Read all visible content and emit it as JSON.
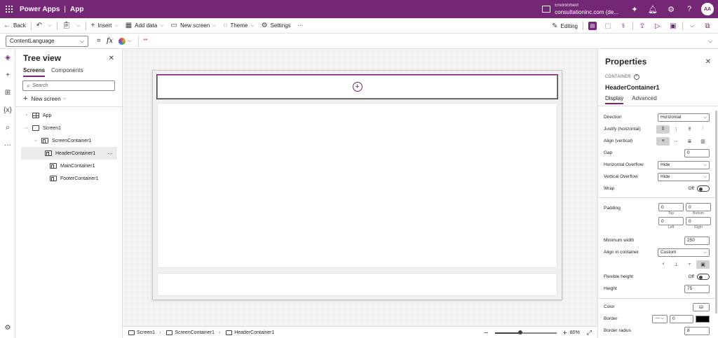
{
  "appbar": {
    "product": "Power Apps",
    "app": "App",
    "env_label": "Environment",
    "env_name": "consultationinc.com (de...",
    "avatar": "AA"
  },
  "commandbar": {
    "back": "Back",
    "insert": "Insert",
    "add_data": "Add data",
    "new_screen": "New screen",
    "theme": "Theme",
    "settings": "Settings",
    "more": "···",
    "editing": "Editing"
  },
  "formulabar": {
    "property": "ContentLanguage",
    "equals": "=",
    "fx": "fx",
    "formula": "\"\""
  },
  "tree": {
    "title": "Tree view",
    "tabs": [
      "Screens",
      "Components"
    ],
    "search_placeholder": "Search",
    "new_screen": "New screen",
    "nodes": [
      "App",
      "Screen1",
      "ScreenContainer1",
      "HeaderContainer1",
      "MainContainer1",
      "FooterContainer1"
    ],
    "more": "···"
  },
  "breadcrumb": [
    "Screen1",
    "ScreenContainer1",
    "HeaderContainer1"
  ],
  "zoom": {
    "level": "80%",
    "fraction": 0.4
  },
  "properties": {
    "title": "Properties",
    "kind": "CONTAINER",
    "name": "HeaderContainer1",
    "tabs": [
      "Display",
      "Advanced"
    ],
    "direction_label": "Direction",
    "direction_value": "Horizontal",
    "justify_label": "Justify (horizontal)",
    "align_label": "Align (vertical)",
    "gap_label": "Gap",
    "gap_value": "0",
    "hoverflow_label": "Horizontal Overflow",
    "hoverflow_value": "Hide",
    "voverflow_label": "Vertical Overflow",
    "voverflow_value": "Hide",
    "wrap_label": "Wrap",
    "wrap_value": "Off",
    "padding_label": "Padding",
    "pad_top": "0",
    "pad_bottom": "0",
    "pad_left": "0",
    "pad_right": "0",
    "cap_top": "Top",
    "cap_bottom": "Bottom",
    "cap_left": "Left",
    "cap_right": "Right",
    "minwidth_label": "Minimum width",
    "minwidth_value": "250",
    "align_container_label": "Align in container",
    "align_container_value": "Custom",
    "flexheight_label": "Flexible height",
    "flexheight_value": "Off",
    "height_label": "Height",
    "height_value": "75",
    "color_label": "Color",
    "border_label": "Border",
    "border_value": "0",
    "border_color": "#000000",
    "radius_label": "Border radius",
    "radius_value": "8"
  },
  "colors": {
    "brand": "#742774",
    "formula_text": "#a4262c"
  }
}
